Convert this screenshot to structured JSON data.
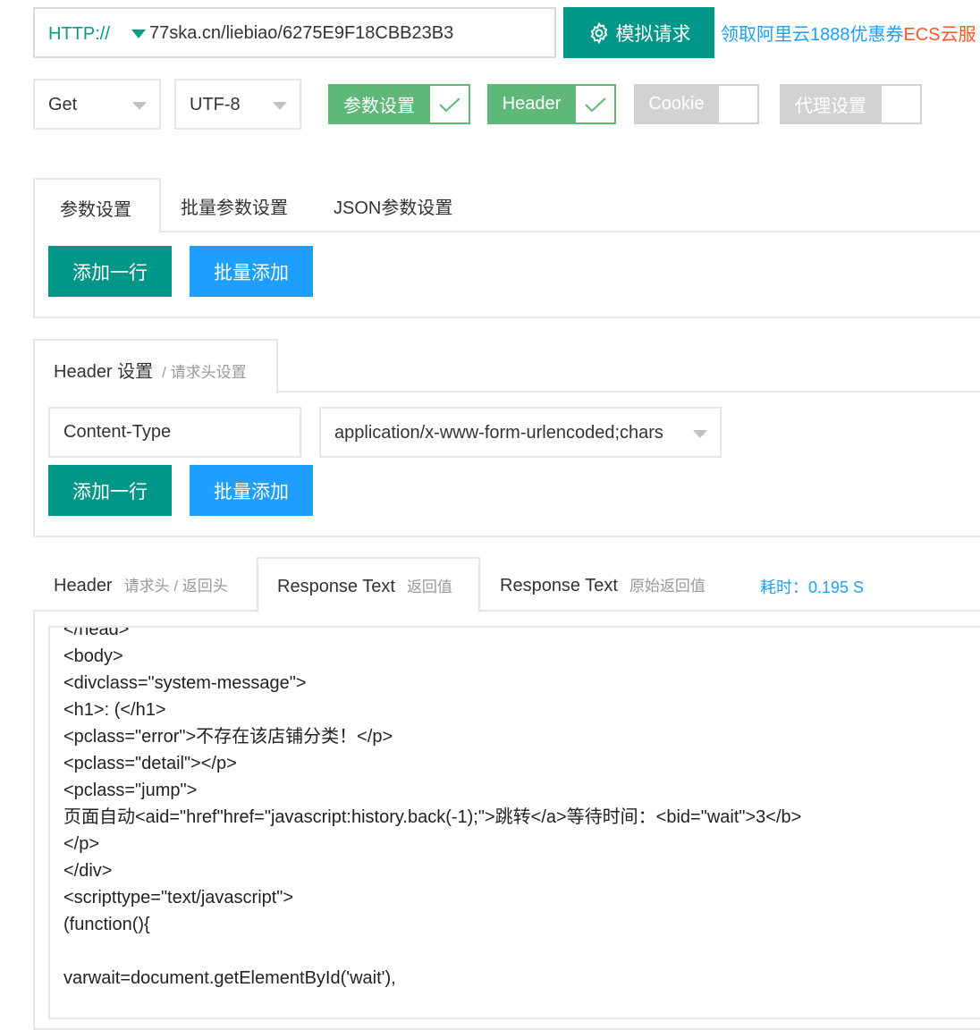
{
  "url": {
    "protocol": "HTTP://",
    "value": "77ska.cn/liebiao/6275E9F18CBB23B3"
  },
  "simulate_button": {
    "label": "模拟请求"
  },
  "promo": {
    "blue_text": "领取阿里云1888优惠券",
    "orange_text": "ECS云服"
  },
  "method_select": {
    "value": "Get"
  },
  "charset_select": {
    "value": "UTF-8"
  },
  "toggles": {
    "params": {
      "label": "参数设置",
      "on": true
    },
    "header": {
      "label": "Header",
      "on": true
    },
    "cookie": {
      "label": "Cookie",
      "on": false
    },
    "proxy": {
      "label": "代理设置",
      "on": false
    }
  },
  "params_panel": {
    "tabs": [
      "参数设置",
      "批量参数设置",
      "JSON参数设置"
    ],
    "add_row_label": "添加一行",
    "batch_add_label": "批量添加"
  },
  "header_panel": {
    "title": "Header 设置",
    "subtitle": "/ 请求头设置",
    "key_value": "Content-Type",
    "value_select": "application/x-www-form-urlencoded;chars",
    "add_row_label": "添加一行",
    "batch_add_label": "批量添加"
  },
  "response_tabs": {
    "tab1_title": "Header",
    "tab1_sub": "请求头 / 返回头",
    "tab2_title": "Response Text",
    "tab2_sub": "返回值",
    "tab3_title": "Response Text",
    "tab3_sub": "原始返回值",
    "timing": "耗时：0.195 S"
  },
  "response_lines": [
    "</head>",
    "<body>",
    "<divclass=\"system-message\">",
    "<h1>: (</h1>",
    "<pclass=\"error\">不存在该店铺分类！</p>",
    "<pclass=\"detail\"></p>",
    "<pclass=\"jump\">",
    "页面自动<aid=\"href\"href=\"javascript:history.back(-1);\">跳转</a>等待时间：<bid=\"wait\">3</b>",
    "</p>",
    "</div>",
    "<scripttype=\"text/javascript\">",
    "(function(){",
    "",
    "varwait=document.getElementById('wait'),"
  ],
  "colors": {
    "primary": "#009688",
    "blue": "#1e9fff",
    "toggle_on": "#5fb878",
    "toggle_off": "#d2d2d2",
    "promo_orange": "#ff5722"
  }
}
